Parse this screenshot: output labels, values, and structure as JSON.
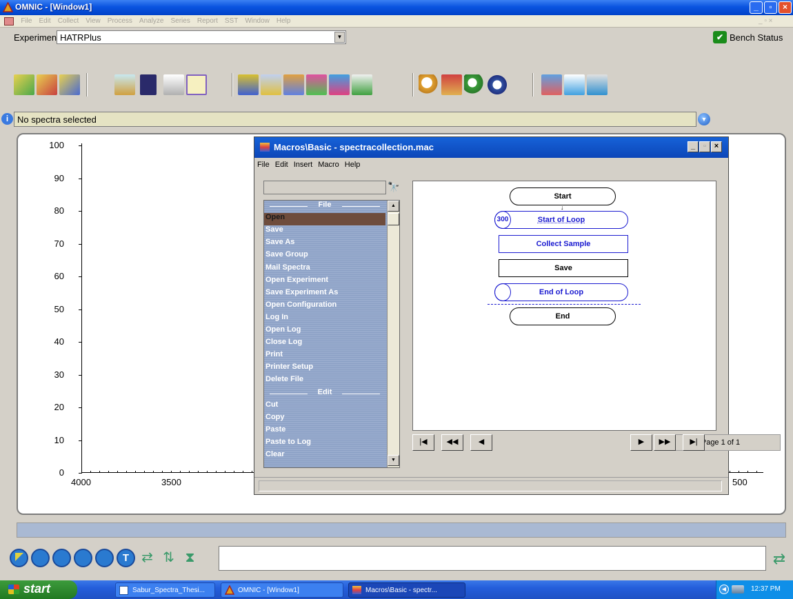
{
  "window": {
    "title": "OMNIC - [Window1]"
  },
  "menu": [
    "File",
    "Edit",
    "Collect",
    "View",
    "Process",
    "Analyze",
    "Series",
    "Report",
    "SST",
    "Window",
    "Help"
  ],
  "experiment": {
    "label": "Experiment:",
    "value": "HATRPlus",
    "bench_status": "Bench Status"
  },
  "info": {
    "text": "No spectra selected"
  },
  "plot": {
    "y_ticks": [
      "100",
      "90",
      "80",
      "70",
      "60",
      "50",
      "40",
      "30",
      "20",
      "10",
      "0"
    ],
    "x_ticks": [
      "4000",
      "3500",
      "500"
    ]
  },
  "macro_window": {
    "title": "Macros\\Basic - spectracollection.mac",
    "menu": [
      "File",
      "Edit",
      "Insert",
      "Macro",
      "Help"
    ],
    "list": {
      "section_file": "File",
      "file_items": [
        "Open",
        "Save",
        "Save As",
        "Save Group",
        "Mail Spectra",
        "Open Experiment",
        "Save Experiment As",
        "Open Configuration",
        "Log In",
        "Open Log",
        "Close Log",
        "Print",
        "Printer Setup",
        "Delete File"
      ],
      "section_edit": "Edit",
      "edit_items": [
        "Cut",
        "Copy",
        "Paste",
        "Paste to Log",
        "Clear"
      ]
    },
    "flow": {
      "start": "Start",
      "loop_count": "300",
      "start_loop": "Start of Loop",
      "collect_sample": "Collect Sample",
      "save": "Save",
      "end_loop": "End of Loop",
      "end": "End"
    },
    "page": "Page 1 of 1"
  },
  "taskbar": {
    "start": "start",
    "tasks": [
      "Sabur_Spectra_Thesi...",
      "OMNIC - [Window1]",
      "Macros\\Basic - spectr..."
    ],
    "clock": "12:37 PM"
  },
  "colors": {
    "accent": "#0a54e0",
    "list_bg": "#8fa4c8",
    "flow_blue": "#1a1ad0",
    "selected": "#6e4c3c"
  }
}
